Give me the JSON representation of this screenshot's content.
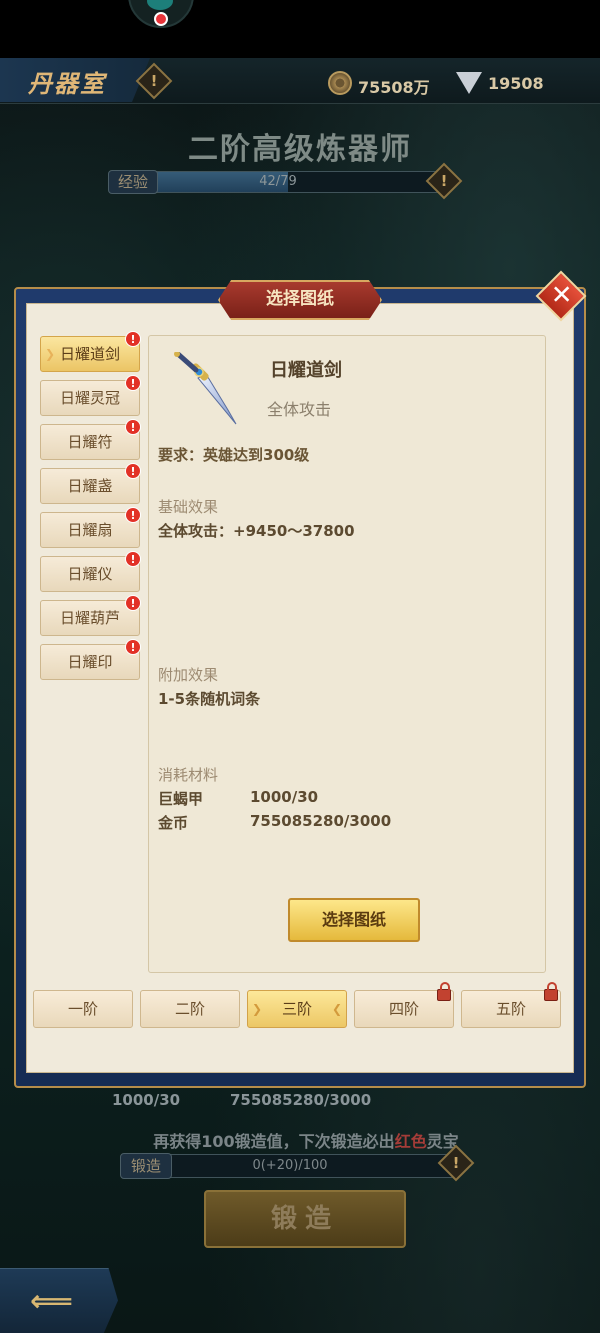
{
  "header": {
    "room_title": "丹器室",
    "info_icon": "!",
    "gold": "75508万",
    "gems": "19508"
  },
  "rank": {
    "title": "二阶高级炼器师",
    "exp_label": "经验",
    "exp_text": "42/79",
    "exp_progress": 0.53
  },
  "modal": {
    "title": "选择图纸",
    "close": "✕",
    "tabs": [
      {
        "label": "日耀道剑",
        "active": true
      },
      {
        "label": "日耀灵冠"
      },
      {
        "label": "日耀符"
      },
      {
        "label": "日耀盏"
      },
      {
        "label": "日耀扇"
      },
      {
        "label": "日耀仪"
      },
      {
        "label": "日耀葫芦"
      },
      {
        "label": "日耀印"
      }
    ],
    "badge": "!",
    "item": {
      "name": "日耀道剑",
      "subtitle": "全体攻击",
      "requirement": "要求：英雄达到300级",
      "base_label": "基础效果",
      "base_text": "全体攻击：+9450～37800",
      "extra_label": "附加效果",
      "extra_text": "1-5条随机词条",
      "materials_label": "消耗材料",
      "materials": [
        {
          "name": "巨蝎甲",
          "value": "1000/30"
        },
        {
          "name": "金币",
          "value": "755085280/3000"
        }
      ]
    },
    "select_button": "选择图纸",
    "tiers": [
      "一阶",
      "二阶",
      "三阶",
      "四阶",
      "五阶"
    ]
  },
  "bottom": {
    "amt1": "1000/30",
    "amt2": "755085280/3000",
    "hint_pre": "再获得100锻造值，下次锻造必出",
    "hint_red": "红色",
    "hint_post": "灵宝",
    "forge_label": "锻造",
    "forge_text": "0(+20)/100",
    "forge_button": "锻造"
  },
  "colors": {
    "accent_gold": "#ebc565",
    "highlight_red": "#a43c38",
    "panel_bg": "#f0eadb"
  }
}
